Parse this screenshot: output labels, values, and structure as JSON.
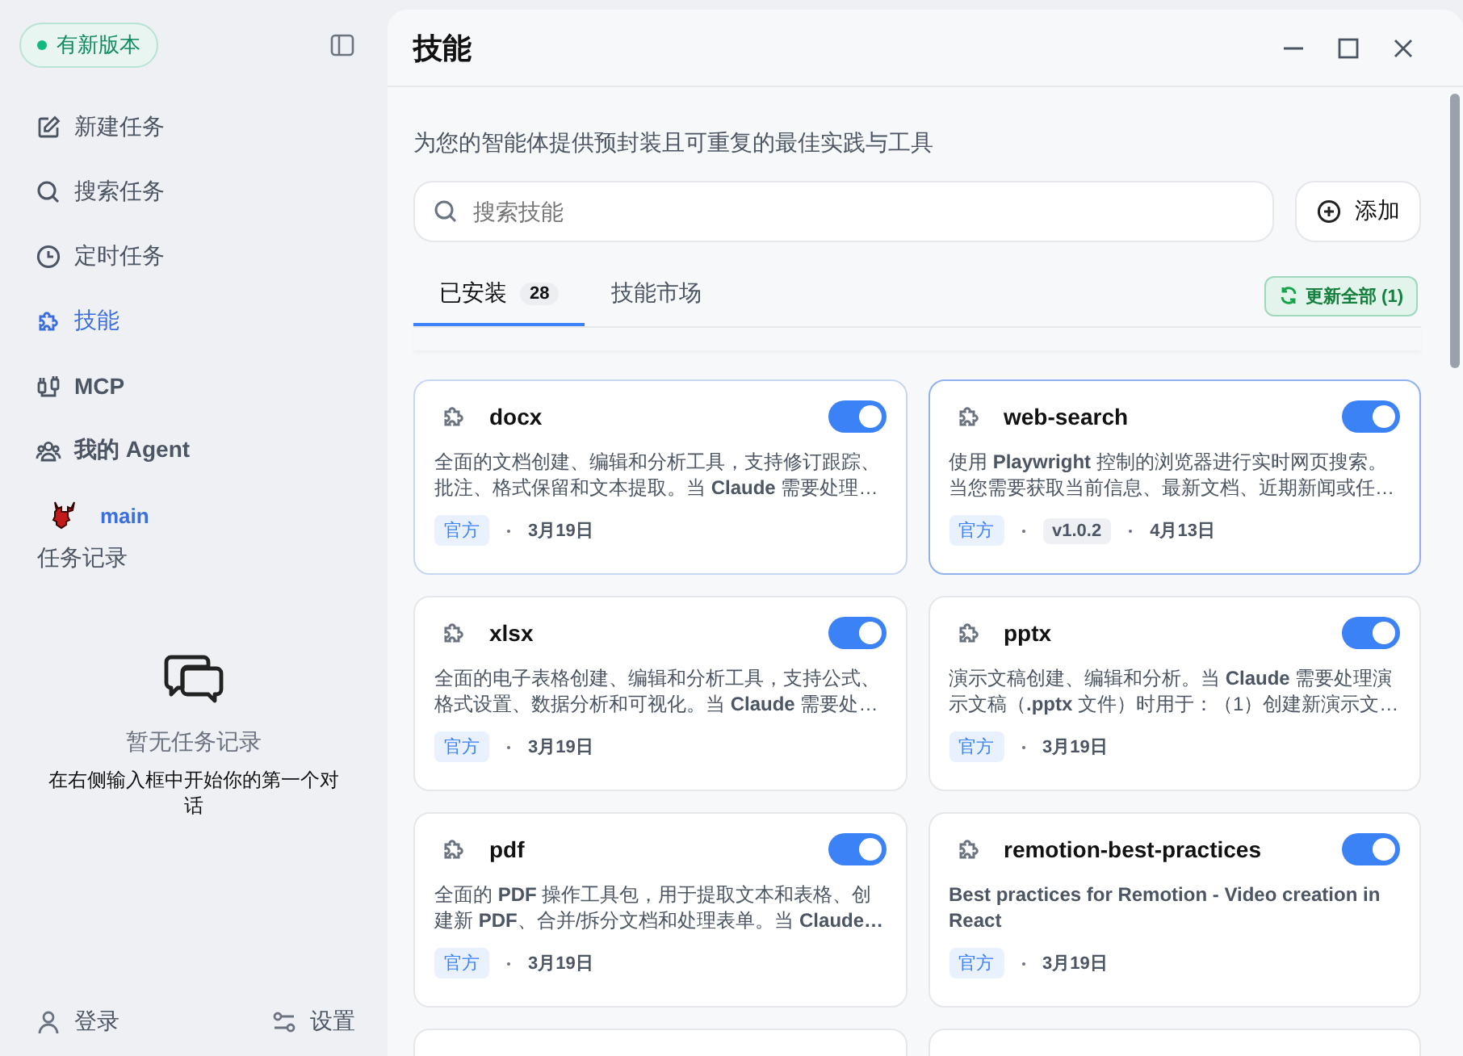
{
  "sidebar": {
    "update_badge": "有新版本",
    "nav_items": [
      {
        "label": "新建任务",
        "selected": false
      },
      {
        "label": "搜索任务",
        "selected": false
      },
      {
        "label": "定时任务",
        "selected": false
      },
      {
        "label": "技能",
        "selected": true
      },
      {
        "label": "MCP",
        "selected": false
      },
      {
        "label": "我的 Agent",
        "selected": false
      }
    ],
    "agent": {
      "name": "main"
    },
    "history_heading": "任务记录",
    "empty_state": {
      "title": "暂无任务记录",
      "hint": "在右侧输入框中开始你的第一个对话"
    },
    "footer": {
      "login": "登录",
      "settings": "设置"
    }
  },
  "window": {
    "title": "技能"
  },
  "subtitle": "为您的智能体提供预封装且可重复的最佳实践与工具",
  "search": {
    "placeholder": "搜索技能"
  },
  "add_button": "添加",
  "tabs": [
    {
      "label": "已安装",
      "count": "28",
      "selected": true
    },
    {
      "label": "技能市场",
      "selected": false
    }
  ],
  "update_all_button": "更新全部 (1)",
  "skills": [
    {
      "name": "docx",
      "on": true,
      "selected": false,
      "description": "全面的文档创建、编辑和分析工具，支持修订跟踪、批注、格式保留和文本提取。当 **Claude** 需要处理…",
      "source": "官方",
      "date": "3月19日"
    },
    {
      "name": "web-search",
      "on": true,
      "selected": true,
      "description": "使用 **Playwright** 控制的浏览器进行实时网页搜索。当您需要获取当前信息、最新文档、近期新闻或任…",
      "source": "官方",
      "version": "v1.0.2",
      "date": "4月13日"
    },
    {
      "name": "xlsx",
      "on": true,
      "selected": false,
      "description": "全面的电子表格创建、编辑和分析工具，支持公式、格式设置、数据分析和可视化。当 **Claude** 需要处…",
      "source": "官方",
      "date": "3月19日"
    },
    {
      "name": "pptx",
      "on": true,
      "selected": false,
      "description": "演示文稿创建、编辑和分析。当 **Claude** 需要处理演示文稿（**.pptx** 文件）时用于：（1）创建新演示文…",
      "source": "官方",
      "date": "3月19日"
    },
    {
      "name": "pdf",
      "on": true,
      "selected": false,
      "description": "全面的 **PDF** 操作工具包，用于提取文本和表格、创建新 **PDF**、合并/拆分文档和处理表单。当 **Claude…**",
      "source": "官方",
      "date": "3月19日"
    },
    {
      "name": "remotion-best-practices",
      "on": true,
      "selected": false,
      "description": "**Best practices for Remotion - Video creation in React**",
      "source": "官方",
      "date": "3月19日"
    }
  ]
}
